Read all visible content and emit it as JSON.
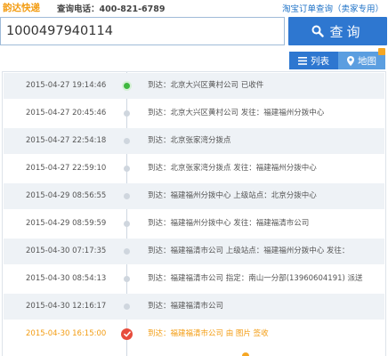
{
  "header": {
    "brand": "韵达快递",
    "hotline": "查询电话：400-821-6789",
    "taobao_link": "淘宝订单查询（卖家专用）"
  },
  "search": {
    "value": "1000497940114",
    "button_label": "查询"
  },
  "views": {
    "list_label": "列表",
    "map_label": "地图"
  },
  "records": [
    {
      "time": "2015-04-27 19:14:46",
      "desc": "到达：北京大兴区黄村公司 已收件"
    },
    {
      "time": "2015-04-27 20:45:46",
      "desc": "到达：北京大兴区黄村公司 发往：福建福州分拨中心"
    },
    {
      "time": "2015-04-27 22:54:18",
      "desc": "到达：北京张家湾分拨点"
    },
    {
      "time": "2015-04-27 22:59:10",
      "desc": "到达：北京张家湾分拨点 发往：福建福州分拨中心"
    },
    {
      "time": "2015-04-29 08:56:55",
      "desc": "到达：福建福州分拨中心 上级站点：北京分拨中心"
    },
    {
      "time": "2015-04-29 08:59:59",
      "desc": "到达：福建福州分拨中心 发往：福建福清市公司"
    },
    {
      "time": "2015-04-30 07:17:35",
      "desc": "到达：福建福清市公司 上级站点：福建福州分拨中心 发往："
    },
    {
      "time": "2015-04-30 08:54:13",
      "desc": "到达：福建福清市公司 指定：南山一分部(13960604191) 派送"
    },
    {
      "time": "2015-04-30 12:16:17",
      "desc": "到达：福建福清市公司"
    },
    {
      "time": "2015-04-30 16:15:00",
      "desc": "到达：福建福清市公司 由 图片 签收"
    }
  ],
  "colors": {
    "accent": "#2e77d0",
    "brand": "#f39c12",
    "row_bg": "#eef2f6",
    "done": "#3fb83f",
    "signed": "#e74c3c"
  }
}
